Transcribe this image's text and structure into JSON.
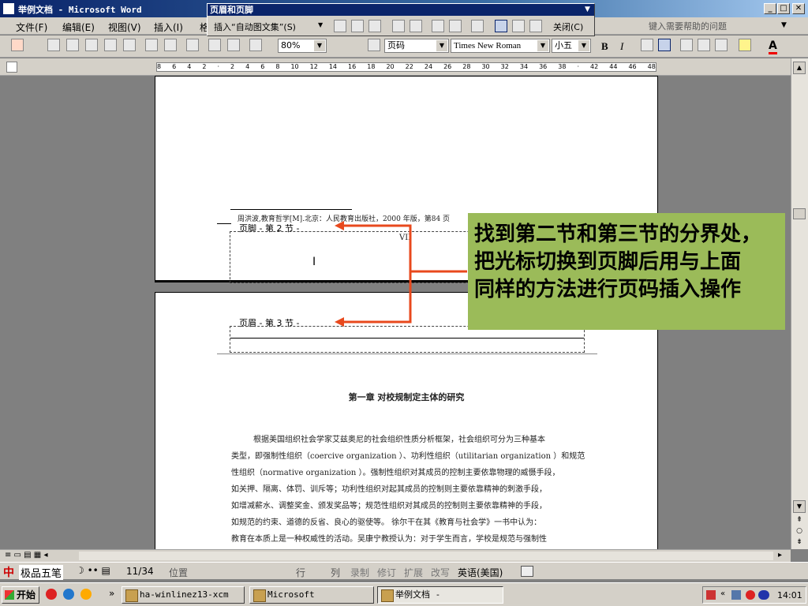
{
  "window": {
    "title": "举例文档 - Microsoft Word",
    "minimize": "_",
    "maximize": "□",
    "close": "✕"
  },
  "menubar": {
    "items": [
      "文件(F)",
      "编辑(E)",
      "视图(V)",
      "插入(I)",
      "格"
    ],
    "help_placeholder": "键入需要帮助的问题"
  },
  "hf_toolbar": {
    "title": "页眉和页脚",
    "insert_autotext": "插入“自动图文集”(S)",
    "close": "关闭(C)"
  },
  "format_toolbar": {
    "zoom": "80%",
    "style": "页码",
    "font": "Times New Roman",
    "size": "小五",
    "bold": "B",
    "italic": "I",
    "font_color_label": "A"
  },
  "ruler": {
    "ticks": [
      "8",
      "6",
      "4",
      "2",
      "",
      "2",
      "4",
      "6",
      "8",
      "10",
      "12",
      "14",
      "16",
      "18",
      "20",
      "22",
      "24",
      "26",
      "28",
      "30",
      "32",
      "34",
      "36",
      "38",
      "",
      "42",
      "44",
      "46",
      "48"
    ]
  },
  "document": {
    "footnote": "周洪波,教育哲学[M].北京：人民教育出版社，2000 年版，第84 页",
    "footer_label": "页脚 - 第 2 节 -",
    "page_number": "VII",
    "header_label": "页眉 - 第 3 节 -",
    "chapter_title": "第一章   对校规制定主体的研究",
    "paragraph": [
      "根据美国组织社会学家艾兹奥尼的社会组织性质分析框架，社会组织可分为三种基本",
      "类型，即强制性组织（coercive organization ）、功利性组织（utilitarian organization ）和规范",
      "性组织（normative organization ）。强制性组织对其成员的控制主要依靠物理的威慑手段，",
      "如关押、隔离、体罚、训斥等；功利性组织对起其成员的控制则主要依靠精神的刺激手段，",
      "如增减薪水、调整奖金、颁发奖品等；规范性组织对其成员的控制则主要依靠精神的手段，",
      "如规范的约束、道德的反省、良心的驱使等。  徐尔干在其《教育与社会学》一书中认为：",
      "教育在本质上是一种权威性的活动。吴康宁教授认为：对于学生而言，学校是规范与强制性"
    ]
  },
  "callout": {
    "lines": [
      "找到第二节和第三节的分界处，",
      "把光标切换到页脚后用与上面",
      "同样的方法进行页码插入操作"
    ]
  },
  "statusbar": {
    "ime": "极品五笔",
    "page": "11/34",
    "position": "位置",
    "line": "行",
    "col": "列",
    "rec": "录制",
    "trk": "修订",
    "ext": "扩展",
    "ovr": "改写",
    "lang": "英语(美国)"
  },
  "taskbar": {
    "start": "开始",
    "tasks": [
      "ha-winlinez13-xcm",
      "Microsoft PowerPoin...",
      "举例文档 - Microsof..."
    ],
    "clock": "14:01",
    "more": "»"
  },
  "colors": {
    "callout_bg": "#9bbb59",
    "arrow": "#e8491d",
    "titlebar": "#0a246a"
  }
}
